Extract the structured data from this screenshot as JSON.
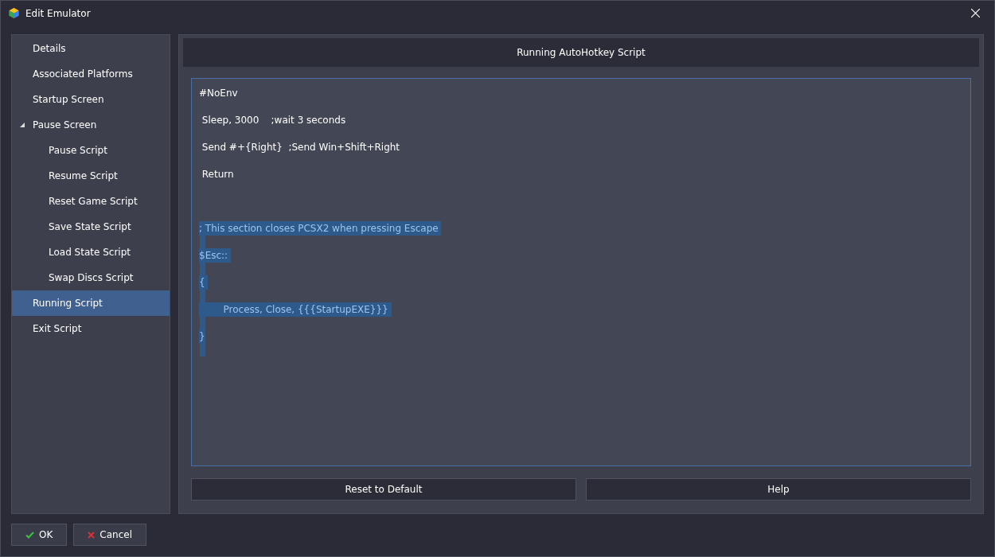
{
  "window": {
    "title": "Edit Emulator"
  },
  "sidebar": {
    "items": [
      {
        "label": "Details",
        "selected": false
      },
      {
        "label": "Associated Platforms",
        "selected": false
      },
      {
        "label": "Startup Screen",
        "selected": false
      },
      {
        "label": "Pause Screen",
        "selected": false,
        "expanded": true,
        "children": [
          {
            "label": "Pause Script",
            "selected": false
          },
          {
            "label": "Resume Script",
            "selected": false
          },
          {
            "label": "Reset Game Script",
            "selected": false
          },
          {
            "label": "Save State Script",
            "selected": false
          },
          {
            "label": "Load State Script",
            "selected": false
          },
          {
            "label": "Swap Discs Script",
            "selected": false
          }
        ]
      },
      {
        "label": "Running Script",
        "selected": true
      },
      {
        "label": "Exit Script",
        "selected": false
      }
    ]
  },
  "panel": {
    "title": "Running AutoHotkey Script",
    "script": {
      "blocks": [
        {
          "selected": false,
          "lines": [
            "#NoEnv",
            " Sleep, 3000    ;wait 3 seconds",
            " Send #+{Right}  ;Send Win+Shift+Right",
            " Return"
          ]
        },
        {
          "selected": true,
          "lines": [
            "; This section closes PCSX2 when pressing Escape ",
            "$Esc:: ",
            "{ ",
            "\t\tProcess, Close, {{{StartupEXE}}} ",
            "}"
          ]
        }
      ]
    },
    "buttons": [
      "Reset to Default",
      "Help"
    ]
  },
  "footer_buttons": [
    {
      "label": "OK",
      "kind": "ok"
    },
    {
      "label": "Cancel",
      "kind": "cancel"
    }
  ]
}
